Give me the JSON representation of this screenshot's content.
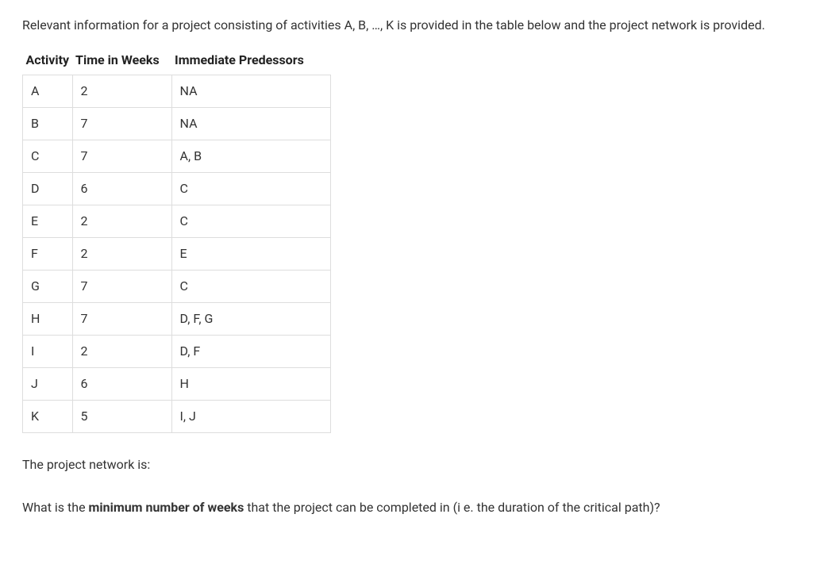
{
  "intro": "Relevant information for a project consisting of activities A, B, …, K is provided in the table below and the project network is provided.",
  "table": {
    "headers": {
      "activity": "Activity",
      "time": "Time in Weeks",
      "predecessors": "Immediate Predessors"
    },
    "rows": [
      {
        "activity": "A",
        "time": "2",
        "predecessors": "NA"
      },
      {
        "activity": "B",
        "time": "7",
        "predecessors": "NA"
      },
      {
        "activity": "C",
        "time": "7",
        "predecessors": "A, B"
      },
      {
        "activity": "D",
        "time": "6",
        "predecessors": "C"
      },
      {
        "activity": "E",
        "time": "2",
        "predecessors": "C"
      },
      {
        "activity": "F",
        "time": "2",
        "predecessors": "E"
      },
      {
        "activity": "G",
        "time": "7",
        "predecessors": "C"
      },
      {
        "activity": "H",
        "time": "7",
        "predecessors": "D, F, G"
      },
      {
        "activity": "I",
        "time": "2",
        "predecessors": "D, F"
      },
      {
        "activity": "J",
        "time": "6",
        "predecessors": "H"
      },
      {
        "activity": "K",
        "time": "5",
        "predecessors": "I, J"
      }
    ]
  },
  "caption": "The project network is:",
  "question": {
    "prefix": "What is the ",
    "bold": "minimum number of weeks",
    "suffix": " that the project can be completed in (i e. the duration of the critical path)?"
  }
}
